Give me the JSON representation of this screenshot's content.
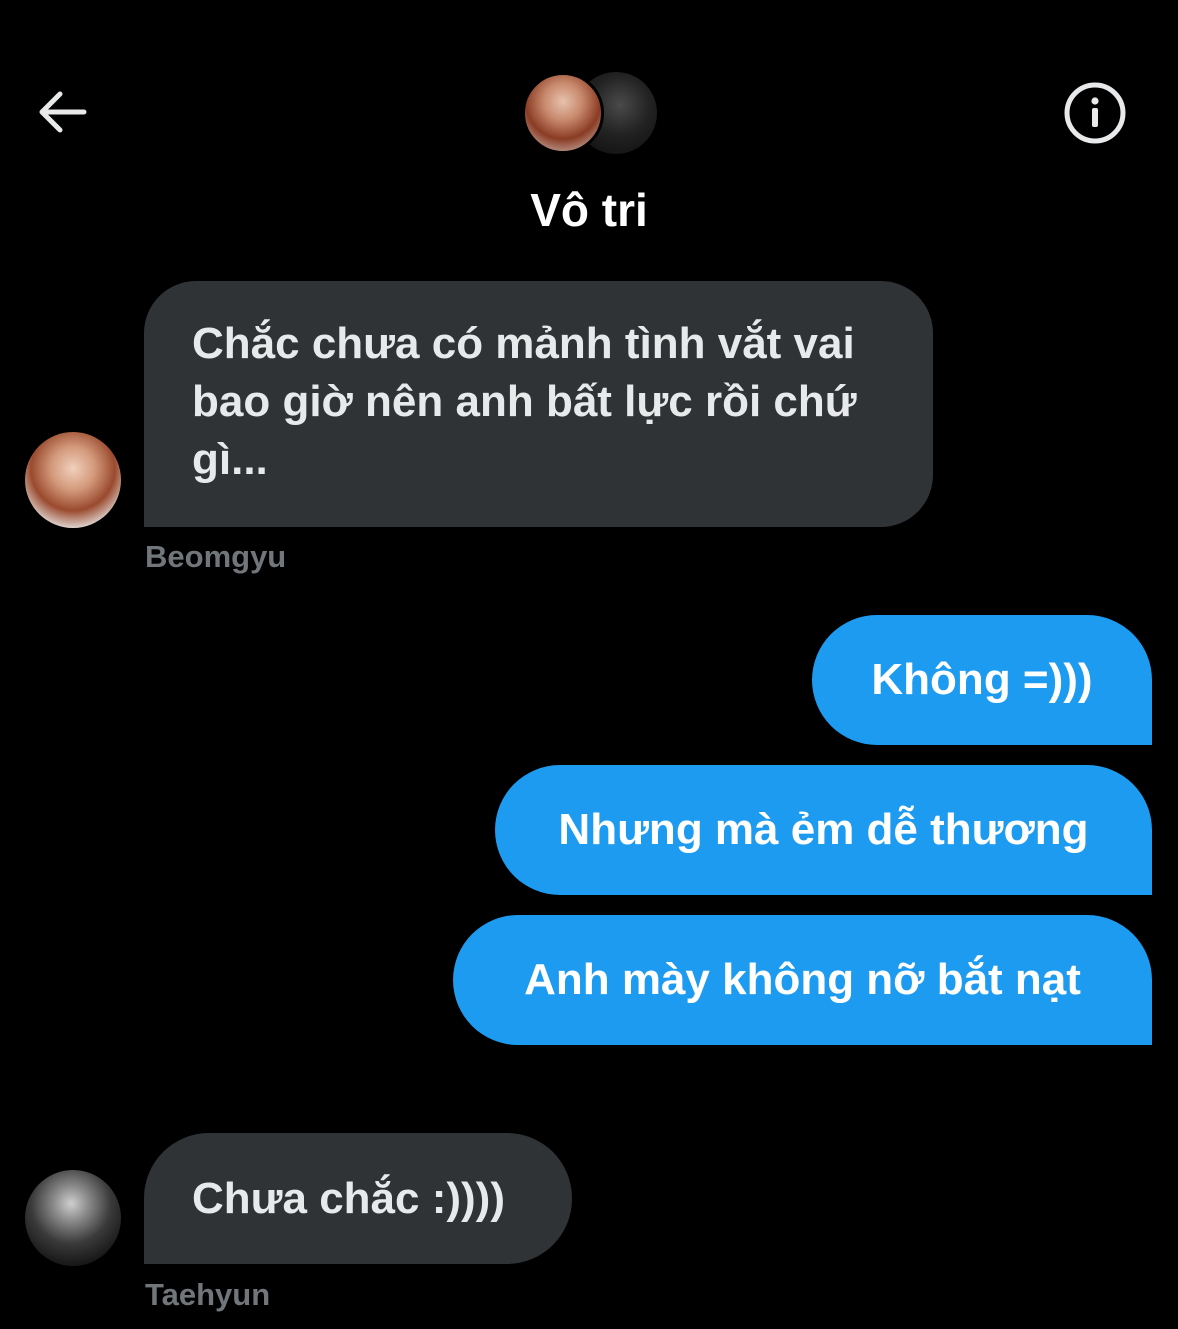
{
  "header": {
    "title": "Vô tri",
    "back_icon": "arrow-left-icon",
    "info_icon": "info-circle-icon"
  },
  "messages": [
    {
      "direction": "incoming",
      "text": "Chắc chưa có mảnh tình vắt vai bao giờ nên anh bất lực rồi chứ gì...",
      "sender": "Beomgyu"
    },
    {
      "direction": "outgoing",
      "text": "Không =)))"
    },
    {
      "direction": "outgoing",
      "text": "Nhưng mà ẻm dễ thương"
    },
    {
      "direction": "outgoing",
      "text": "Anh mày không nỡ bắt nạt"
    },
    {
      "direction": "incoming",
      "text": "Chưa chắc :))))",
      "sender": "Taehyun"
    }
  ],
  "colors": {
    "background": "#000000",
    "incoming_bubble": "#2f3336",
    "outgoing_bubble": "#1d9bf0",
    "sender_name": "#71767b"
  }
}
